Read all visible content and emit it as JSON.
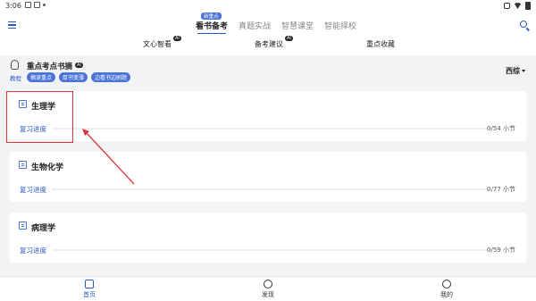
{
  "status_bar": {
    "time": "3:06"
  },
  "main_tabs": [
    {
      "label": "看书备考",
      "active": true,
      "badge": "新重点"
    },
    {
      "label": "真题实战"
    },
    {
      "label": "智慧课堂"
    },
    {
      "label": "智能择校"
    }
  ],
  "sub_tabs": [
    {
      "label": "文心智看",
      "badge": "AI"
    },
    {
      "label": "备考建议",
      "badge": "AI"
    },
    {
      "label": "重点收藏"
    }
  ],
  "section": {
    "title": "重点考点书摘",
    "badge": "AI",
    "tutorial_label": "教程",
    "chips": [
      "摘读重点",
      "厚书变薄",
      "边看书边刷题"
    ],
    "selector": "西综"
  },
  "cards": [
    {
      "title": "生理学",
      "progress_label": "复习进度",
      "count": "0/54 小节",
      "progress": 0
    },
    {
      "title": "生物化学",
      "progress_label": "复习进度",
      "count": "0/77 小节",
      "progress": 0
    },
    {
      "title": "病理学",
      "progress_label": "复习进度",
      "count": "0/59 小节",
      "progress": 0
    }
  ],
  "bottom_nav": [
    {
      "label": "首页",
      "active": true
    },
    {
      "label": "发现"
    },
    {
      "label": "我的"
    }
  ]
}
